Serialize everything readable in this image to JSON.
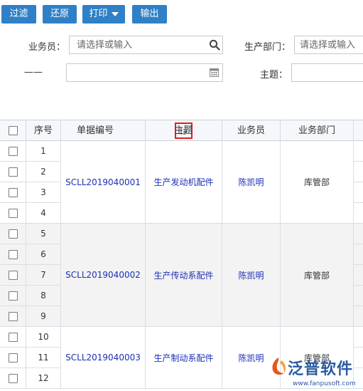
{
  "toolbar": {
    "filter_label": "过滤",
    "restore_label": "还原",
    "print_label": "打印",
    "export_label": "输出"
  },
  "filters": {
    "salesperson_label": "业务员：",
    "salesperson_placeholder": "请选择或输入",
    "dept_label": "生产部门：",
    "dept_placeholder": "请选择或输入",
    "date_label": "——",
    "date_value": "",
    "subject_label": "主题：",
    "subject_value": ""
  },
  "grid": {
    "columns": [
      "",
      "序号",
      "单据编号",
      "主题",
      "业务员",
      "业务部门"
    ],
    "groups": [
      {
        "doc_no": "SCLL2019040001",
        "subject": "生产发动机配件",
        "salesperson": "陈凯明",
        "dept": "库管部",
        "rows": [
          "1",
          "2",
          "3",
          "4"
        ]
      },
      {
        "doc_no": "SCLL2019040002",
        "subject": "生产传动系配件",
        "salesperson": "陈凯明",
        "dept": "库管部",
        "rows": [
          "5",
          "6",
          "7",
          "8",
          "9"
        ]
      },
      {
        "doc_no": "SCLL2019040003",
        "subject": "生产制动系配件",
        "salesperson": "陈凯明",
        "dept": "库管部",
        "rows": [
          "10",
          "11",
          "12"
        ]
      }
    ]
  },
  "watermark": {
    "brand": "泛普软件",
    "url": "www.fanpusoft.com"
  },
  "colors": {
    "toolbar_button": "#2f80c6",
    "link_text": "#1c2fb5",
    "highlight_box": "#e02020",
    "header_bg": "#f5f7fa"
  }
}
